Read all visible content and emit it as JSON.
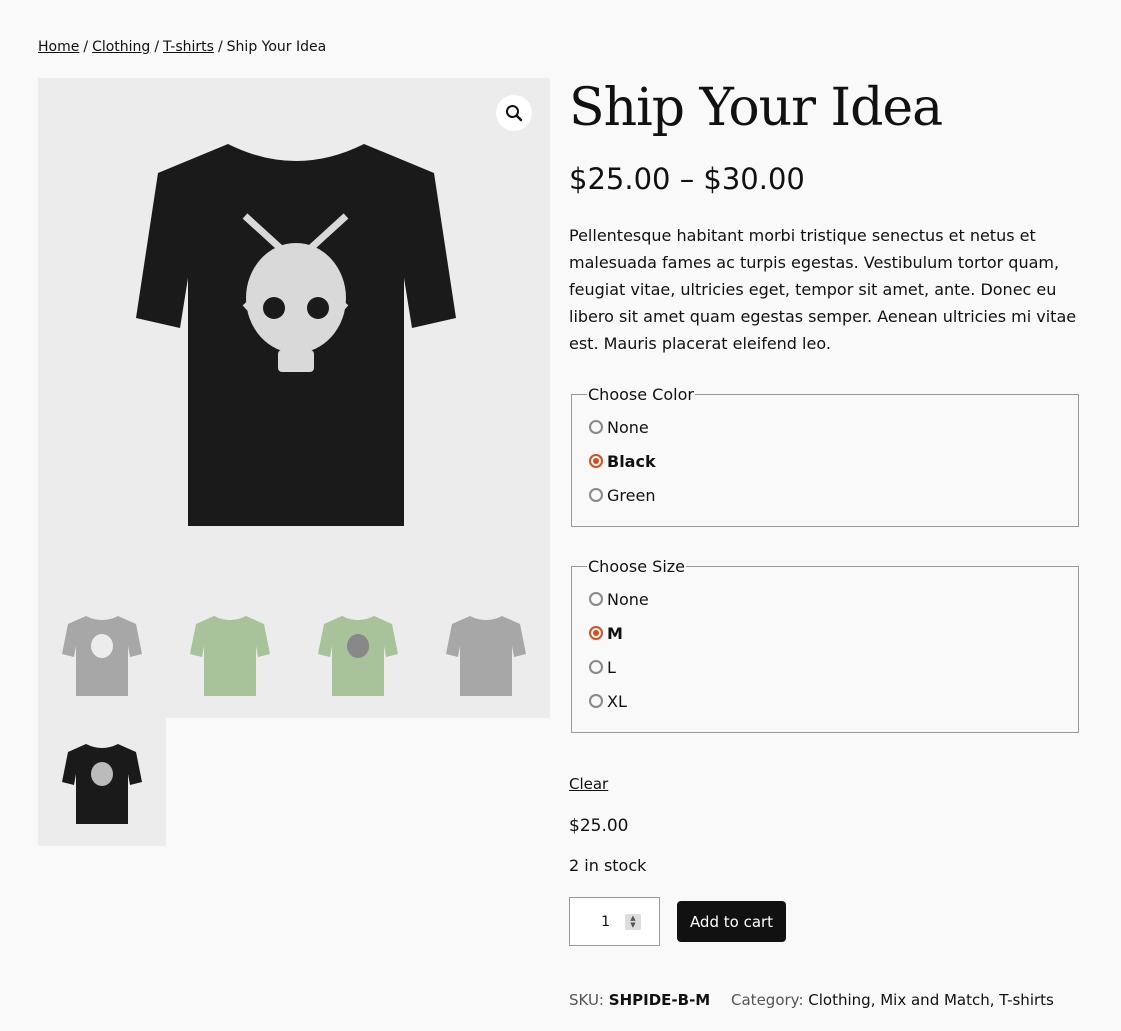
{
  "breadcrumb": {
    "home": "Home",
    "clothing": "Clothing",
    "tshirts": "T-shirts",
    "current": "Ship Your Idea",
    "separator": "/"
  },
  "product": {
    "title": "Ship Your Idea",
    "price_range": "$25.00 – $30.00",
    "description": "Pellentesque habitant morbi tristique senectus et netus et malesuada fames ac turpis egestas. Vestibulum tortor quam, feugiat vitae, ultricies eget, tempor sit amet, ante. Donec eu libero sit amet quam egestas semper. Aenean ultricies mi vitae est. Mauris placerat eleifend leo."
  },
  "gallery": {
    "zoom_icon": "magnifier-icon",
    "main_color": "#1a1a1a",
    "thumbs": [
      {
        "color": "#8a8a8a"
      },
      {
        "color": "#a8c29a"
      },
      {
        "color": "#a8c29a"
      },
      {
        "color": "#8a8a8a"
      },
      {
        "color": "#1a1a1a"
      }
    ]
  },
  "color_choice": {
    "legend": "Choose Color",
    "options": [
      "None",
      "Black",
      "Green"
    ],
    "selected": "Black"
  },
  "size_choice": {
    "legend": "Choose Size",
    "options": [
      "None",
      "M",
      "L",
      "XL"
    ],
    "selected": "M"
  },
  "cart": {
    "clear_label": "Clear",
    "variation_price": "$25.00",
    "stock": "2 in stock",
    "quantity": "1",
    "add_label": "Add to cart"
  },
  "meta": {
    "sku_label": "SKU:",
    "sku": "SHPIDE-B-M",
    "category_label": "Category:",
    "categories": [
      "Clothing",
      "Mix and Match",
      "T-shirts"
    ]
  },
  "colors": {
    "accent": "#d2501f",
    "button": "#111111"
  }
}
